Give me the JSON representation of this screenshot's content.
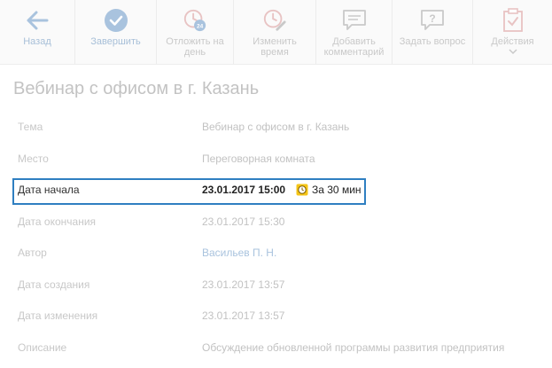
{
  "toolbar": {
    "back": "Назад",
    "complete": "Завершить",
    "postpone": "Отложить на\nдень",
    "postpone_badge": "24",
    "change_time": "Изменить\nвремя",
    "add_comment": "Добавить\nкомментарий",
    "ask_question": "Задать вопрос",
    "actions": "Действия"
  },
  "title": "Вебинар с офисом в г. Казань",
  "fields": [
    {
      "label": "Тема",
      "value": "Вебинар с офисом в г. Казань"
    },
    {
      "label": "Место",
      "value": "Переговорная комната"
    },
    {
      "label": "Дата начала",
      "value": "23.01.2017 15:00"
    },
    {
      "label": "Дата окончания",
      "value": "23.01.2017 15:30"
    },
    {
      "label": "Автор",
      "value": "Васильев П. Н."
    },
    {
      "label": "Дата создания",
      "value": "23.01.2017 13:57"
    },
    {
      "label": "Дата изменения",
      "value": "23.01.2017 13:57"
    },
    {
      "label": "Описание",
      "value": "Обсуждение обновленной программы развития предприятия"
    }
  ],
  "reminder": "За 30 мин",
  "colors": {
    "accent": "#2f7fc1",
    "reminder_icon": "#f5c518",
    "link": "#a9c3de"
  }
}
